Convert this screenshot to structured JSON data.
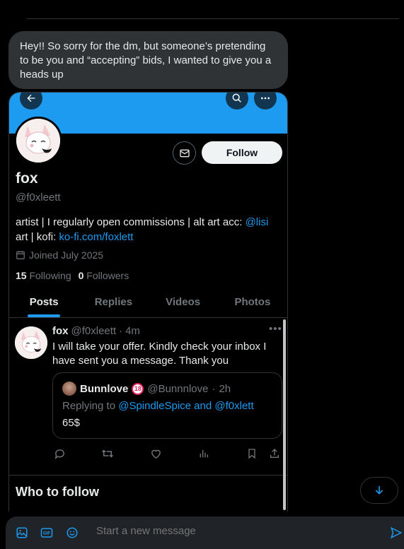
{
  "dm": {
    "message": "Hey!! So sorry for the dm, but someone’s pretending to be you and “accepting” bids, I wanted to give you a heads up"
  },
  "profile": {
    "name": "fox",
    "handle": "@f0xleett",
    "follow_label": "Follow",
    "bio_text": "artist | I regularly open commissions | alt art acc: ",
    "bio_mention": "@lisi",
    "bio_mid": " art | kofi: ",
    "bio_link": "ko-fi.com/foxlett",
    "joined": "Joined July 2025",
    "following_count": "15",
    "following_label": "Following",
    "followers_count": "0",
    "followers_label": "Followers"
  },
  "tabs": [
    {
      "label": "Posts",
      "active": true
    },
    {
      "label": "Replies"
    },
    {
      "label": "Videos"
    },
    {
      "label": "Photos"
    }
  ],
  "tweet": {
    "author": "fox",
    "handle": "@f0xleett",
    "sep": "·",
    "time": "4m",
    "text": "I will take your offer. Kindly check your inbox I have sent you a message. Thank you",
    "quote": {
      "author": "Bunnlove",
      "badge": "18",
      "handle": "@Bunnnlove",
      "sep": "·",
      "time": "2h",
      "replying_prefix": "Replying to ",
      "replying_to": "@SpindleSpice and @f0xlett",
      "text": "65$"
    }
  },
  "who_to_follow": "Who to follow",
  "composer": {
    "placeholder": "Start a new message"
  },
  "colors": {
    "accent": "#1d9bf0",
    "background": "#000000",
    "bubble": "#2f3336",
    "muted": "#71767b"
  }
}
